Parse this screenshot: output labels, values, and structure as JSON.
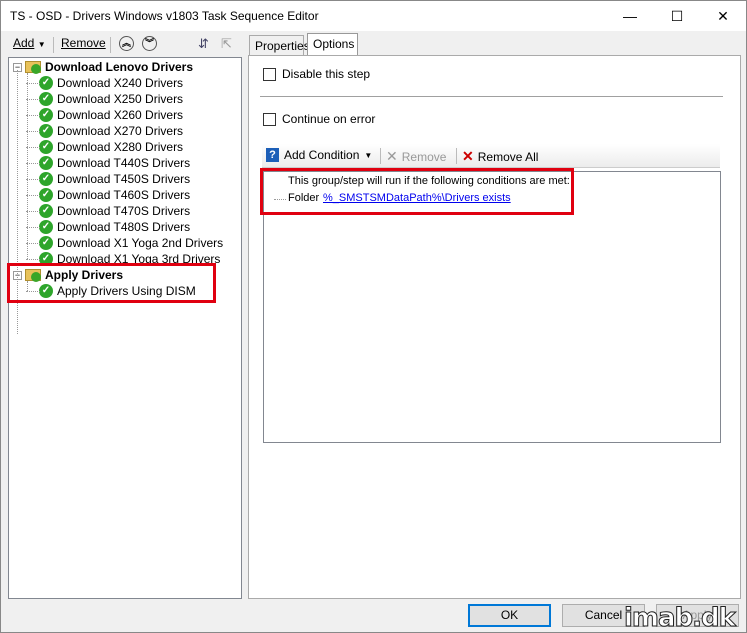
{
  "window": {
    "title": "TS - OSD - Drivers Windows v1803 Task Sequence Editor",
    "minimize": "—",
    "maximize": "☐",
    "close": "✕"
  },
  "toolbar": {
    "add": "Add",
    "remove": "Remove"
  },
  "tree": {
    "groups": [
      {
        "label": "Download Lenovo Drivers",
        "items": [
          "Download X240 Drivers",
          "Download X250 Drivers",
          "Download X260 Drivers",
          "Download X270 Drivers",
          "Download X280 Drivers",
          "Download T440S Drivers",
          "Download T450S Drivers",
          "Download T460S Drivers",
          "Download T470S Drivers",
          "Download T480S Drivers",
          "Download X1 Yoga 2nd Drivers",
          "Download X1 Yoga 3rd Drivers"
        ]
      },
      {
        "label": "Apply Drivers",
        "items": [
          "Apply Drivers Using DISM"
        ]
      }
    ]
  },
  "tabs": [
    "Properties",
    "Options"
  ],
  "options": {
    "disable_step": "Disable this step",
    "continue_on_error": "Continue on error",
    "add_condition": "Add Condition",
    "remove": "Remove",
    "remove_all": "Remove All",
    "condition_header": "This group/step will run if the following conditions are met:",
    "condition_type": "Folder",
    "condition_link": "%_SMSTSMDataPath%\\Drivers exists"
  },
  "buttons": {
    "ok": "OK",
    "cancel": "Cancel",
    "apply": "Apply"
  },
  "watermark": "imab.dk",
  "colors": {
    "highlight": "#e00010",
    "ok_border": "#0078d7",
    "check_green": "#2ea52b"
  }
}
